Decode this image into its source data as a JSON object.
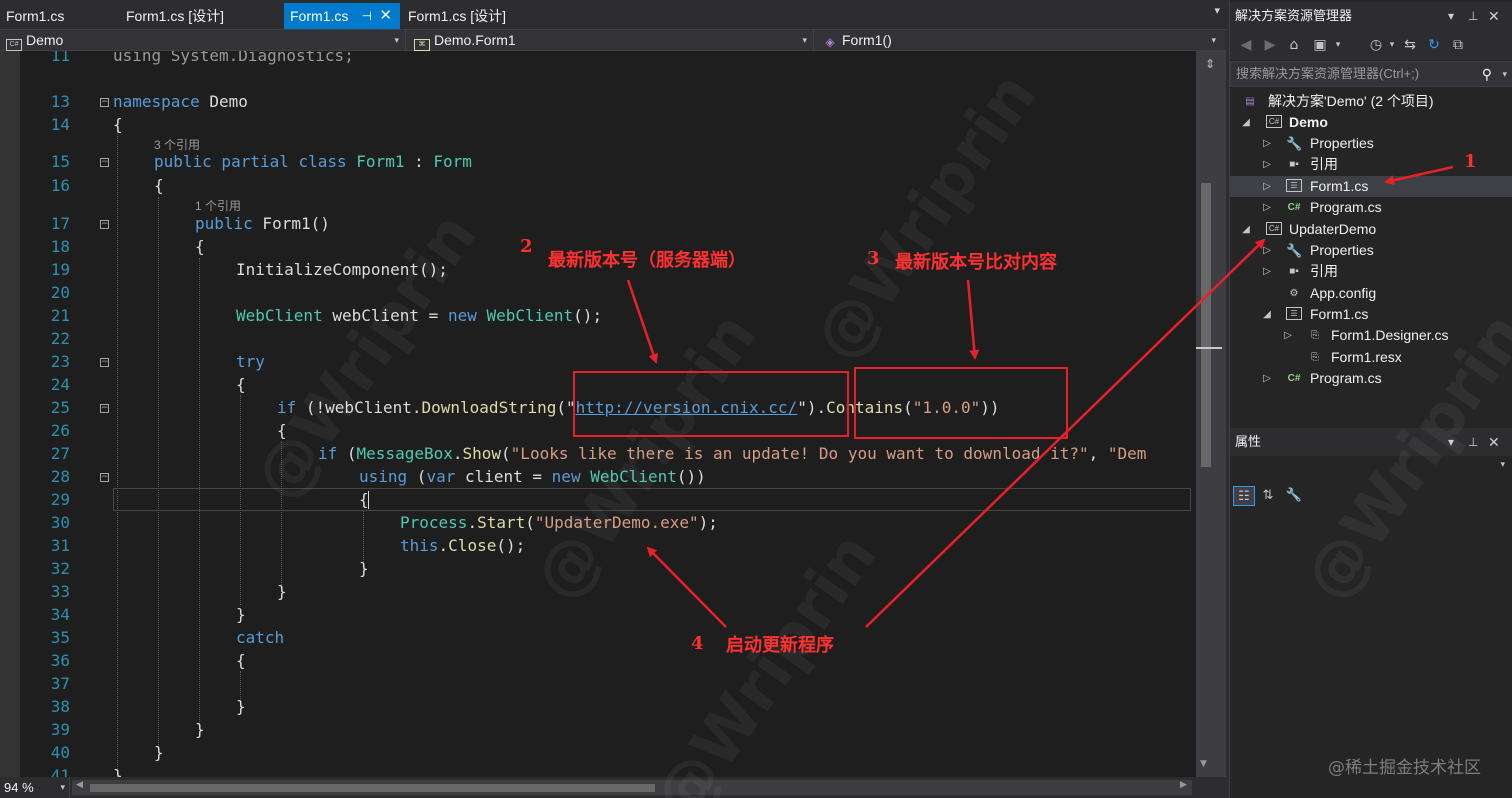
{
  "tabs": [
    {
      "label": "Form1.cs",
      "active": false
    },
    {
      "label": "Form1.cs [设计]",
      "active": false
    },
    {
      "label": "Form1.cs",
      "active": true
    },
    {
      "label": "Form1.cs [设计]",
      "active": false
    }
  ],
  "tab_pin_glyph": "⊣",
  "tab_close_glyph": "✕",
  "navbar": {
    "project": "Demo",
    "class": "Demo.Form1",
    "member": "Form1()"
  },
  "codelens": {
    "class_refs": "3 个引用",
    "ctor_refs": "1 个引用"
  },
  "line_numbers": [
    "11",
    "13",
    "14",
    "15",
    "16",
    "17",
    "18",
    "19",
    "20",
    "21",
    "22",
    "23",
    "24",
    "25",
    "26",
    "27",
    "28",
    "29",
    "30",
    "31",
    "32",
    "33",
    "34",
    "35",
    "36",
    "37",
    "38",
    "39",
    "40",
    "41"
  ],
  "code": {
    "l11": "using System.Diagnostics;",
    "l13_kw": "namespace",
    "l13_name": " Demo",
    "l14": "{",
    "l15_kw": "public partial class",
    "l15_name": " Form1 ",
    "l15_colon": ": ",
    "l15_base": "Form",
    "l16": "{",
    "l17_kw": "public",
    "l17_rest": " Form1()",
    "l18": "{",
    "l19": "InitializeComponent();",
    "l21_type": "WebClient",
    "l21_var": " webClient = ",
    "l21_new": "new",
    "l21_type2": " WebClient",
    "l21_end": "();",
    "l23": "try",
    "l24": "{",
    "l25_if": "if",
    "l25_a": " (!webClient.",
    "l25_method": "DownloadString",
    "l25_q1": "(\"",
    "l25_url": "http://version.cnix.cc/",
    "l25_q2": "\")",
    "l25_dot": ".",
    "l25_contains": "Contains",
    "l25_paren": "(",
    "l25_ver": "\"1.0.0\"",
    "l25_close": "))",
    "l26": "{",
    "l27_if": "if",
    "l27_a": " (",
    "l27_mb": "MessageBox",
    "l27_dot": ".",
    "l27_show": "Show",
    "l27_paren": "(",
    "l27_msg": "\"Looks like there is an update! Do you want to download it?\"",
    "l27_comma": ", ",
    "l27_dem": "\"Dem",
    "l28_using": "using",
    "l28_a": " (",
    "l28_var": "var",
    "l28_b": " client = ",
    "l28_new": "new",
    "l28_type": " WebClient",
    "l28_end": "())",
    "l29": "{",
    "l30_type": "Process",
    "l30_dot": ".",
    "l30_start": "Start",
    "l30_paren": "(",
    "l30_str": "\"UpdaterDemo.exe\"",
    "l30_end": ");",
    "l31_this": "this",
    "l31_dot": ".",
    "l31_close": "Close",
    "l31_end": "();",
    "l32": "}",
    "l33": "}",
    "l34": "}",
    "l35": "catch",
    "l36": "{",
    "l38": "}",
    "l39": "}",
    "l40": "}",
    "l41": "}"
  },
  "status": {
    "zoom": "94 %"
  },
  "solution_explorer": {
    "title": "解决方案资源管理器",
    "search_placeholder": "搜索解决方案资源管理器(Ctrl+;)",
    "items": [
      {
        "label": "解决方案'Demo' (2 个项目)"
      },
      {
        "label": "Demo"
      },
      {
        "label": "Properties"
      },
      {
        "label": "引用"
      },
      {
        "label": "Form1.cs"
      },
      {
        "label": "Program.cs"
      },
      {
        "label": "UpdaterDemo"
      },
      {
        "label": "Properties"
      },
      {
        "label": "引用"
      },
      {
        "label": "App.config"
      },
      {
        "label": "Form1.cs"
      },
      {
        "label": "Form1.Designer.cs"
      },
      {
        "label": "Form1.resx"
      },
      {
        "label": "Program.cs"
      }
    ]
  },
  "properties": {
    "title": "属性"
  },
  "annotations": {
    "n1": "1",
    "n2": "2",
    "t2": "最新版本号（服务器端）",
    "n3": "3",
    "t3": "最新版本号比对内容",
    "n4": "4",
    "t4": "启动更新程序",
    "color": "#ff3030"
  },
  "watermark": "@Wriprin",
  "site_mark": "@稀土掘金技术社区",
  "colors": {
    "accent_tab": "#007acc",
    "editor_bg": "#1e1e1e",
    "keyword": "#569cd6",
    "type": "#4ec9b0",
    "string": "#d69d85",
    "line_number": "#2b91af"
  }
}
